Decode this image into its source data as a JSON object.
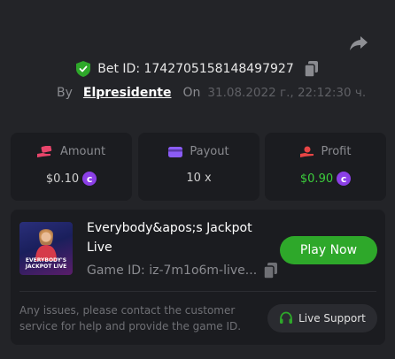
{
  "bet": {
    "id_label": "Bet ID: 1742705158148497927",
    "by_label": "By",
    "username": "Elpresidente",
    "on_label": "On",
    "datetime": "31.08.2022 г., 22:12:30 ч."
  },
  "stats": {
    "amount": {
      "label": "Amount",
      "value": "$0.10"
    },
    "payout": {
      "label": "Payout",
      "value": "10 x"
    },
    "profit": {
      "label": "Profit",
      "value": "$0.90"
    }
  },
  "game": {
    "title": "Everybody&apos;s Jackpot Live",
    "thumb_text": "EVERYBODY'S JACKPOT LIVE",
    "id_label": "Game ID: iz-7m1o6m-live...",
    "play_label": "Play Now",
    "help_text": "Any issues, please contact the customer service for help and provide the game ID.",
    "support_label": "Live Support"
  },
  "colors": {
    "background": "#232428",
    "panel": "#1b1c20",
    "accent_green": "#2ea82a",
    "profit_green": "#3ccc3c",
    "coin_purple": "#8b3fe6",
    "amount_pink": "#e8456b",
    "payout_purple": "#8b5cf6",
    "profit_red": "#e84545"
  },
  "icons": [
    "share-icon",
    "shield-check-icon",
    "copy-icon",
    "cash-hand-icon",
    "wallet-card-icon",
    "profit-hand-icon",
    "coin-icon",
    "headset-icon"
  ]
}
